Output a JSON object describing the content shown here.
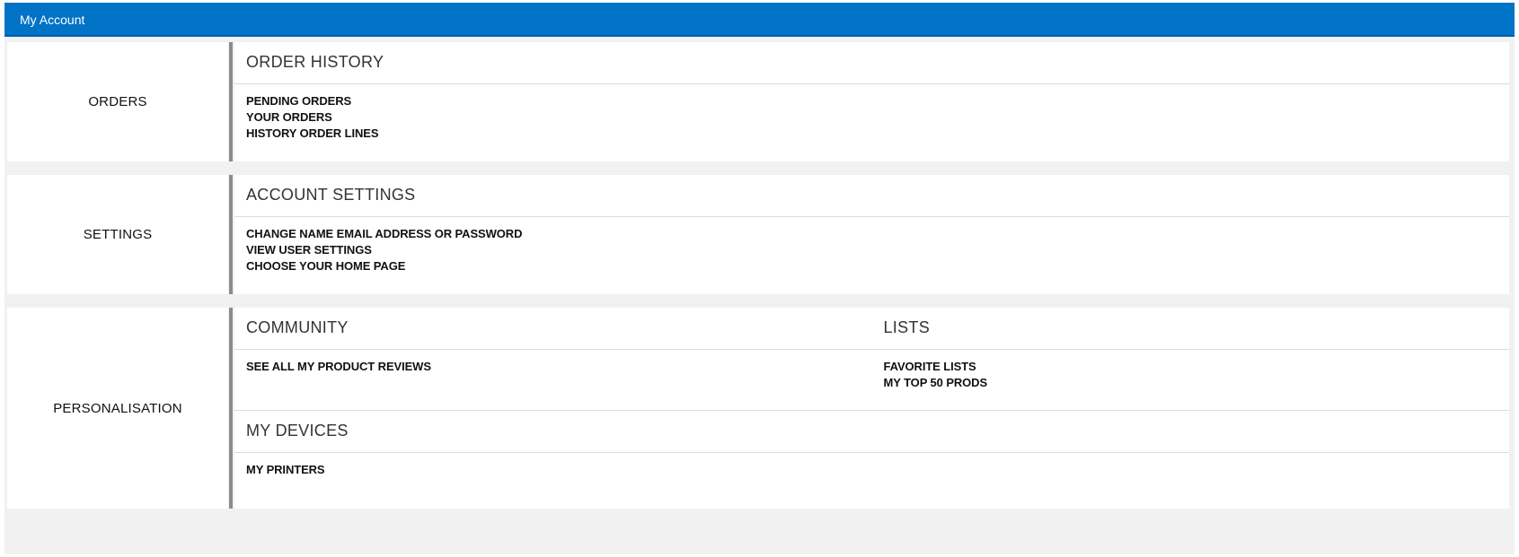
{
  "header": {
    "title": "My Account"
  },
  "sections": [
    {
      "label": "ORDERS",
      "groups": [
        {
          "title": "ORDER HISTORY",
          "links": [
            "PENDING ORDERS",
            "YOUR ORDERS",
            "HISTORY ORDER LINES"
          ]
        }
      ]
    },
    {
      "label": "SETTINGS",
      "groups": [
        {
          "title": "ACCOUNT SETTINGS",
          "links": [
            "CHANGE NAME EMAIL ADDRESS OR PASSWORD",
            "VIEW USER SETTINGS",
            "CHOOSE YOUR HOME PAGE"
          ]
        }
      ]
    },
    {
      "label": "PERSONALISATION",
      "groups": [
        {
          "title": "COMMUNITY",
          "links": [
            "SEE ALL MY PRODUCT REVIEWS"
          ]
        },
        {
          "title": "LISTS",
          "links": [
            "FAVORITE LISTS",
            "MY TOP 50 PRODS"
          ]
        },
        {
          "title": "MY DEVICES",
          "links": [
            "MY PRINTERS"
          ]
        }
      ]
    }
  ],
  "colors": {
    "header_bg": "#0073c6",
    "page_bg": "#f1f1f1",
    "section_bar": "#8c8c8c"
  }
}
